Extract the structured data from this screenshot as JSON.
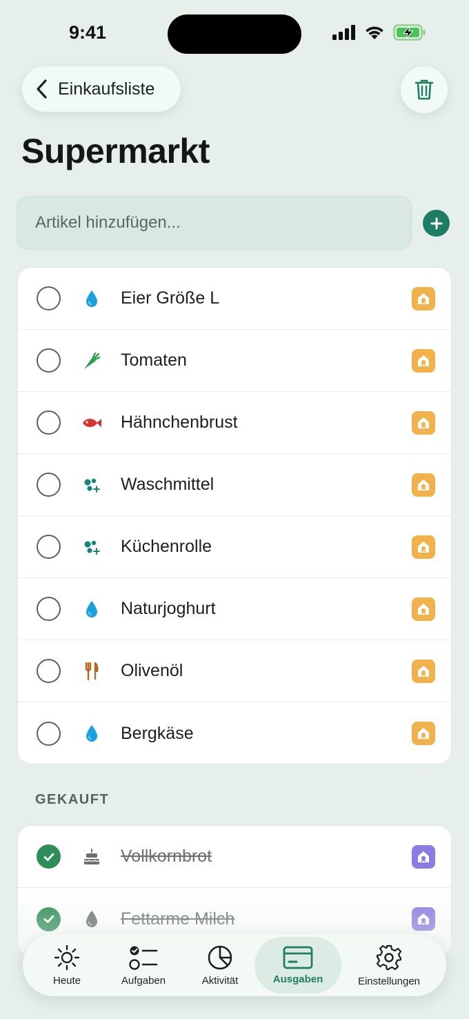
{
  "status": {
    "time": "9:41"
  },
  "header": {
    "back_label": "Einkaufsliste",
    "title": "Supermarkt"
  },
  "add": {
    "placeholder": "Artikel hinzufügen..."
  },
  "open_items": [
    {
      "name": "Eier Größe L",
      "icon": "water-drop-icon",
      "icon_color": "#1aa0e0"
    },
    {
      "name": "Tomaten",
      "icon": "carrot-icon",
      "icon_color": "#2a9d4a"
    },
    {
      "name": "Hähnchenbrust",
      "icon": "fish-icon",
      "icon_color": "#d8332b"
    },
    {
      "name": "Waschmittel",
      "icon": "bubbles-icon",
      "icon_color": "#14857a"
    },
    {
      "name": "Küchenrolle",
      "icon": "bubbles-icon",
      "icon_color": "#14857a"
    },
    {
      "name": "Naturjoghurt",
      "icon": "water-drop-icon",
      "icon_color": "#1aa0e0"
    },
    {
      "name": "Olivenöl",
      "icon": "fork-knife-icon",
      "icon_color": "#b5651d"
    },
    {
      "name": "Bergkäse",
      "icon": "water-drop-icon",
      "icon_color": "#1aa0e0"
    }
  ],
  "bought_label": "GEKAUFT",
  "bought_items": [
    {
      "name": "Vollkornbrot",
      "icon": "cake-icon",
      "icon_color": "#6b6f72"
    },
    {
      "name": "Fettarme Milch",
      "icon": "water-drop-icon",
      "icon_color": "#6b6f72"
    }
  ],
  "tabs": [
    {
      "label": "Heute",
      "icon": "sun-icon"
    },
    {
      "label": "Aufgaben",
      "icon": "checklist-icon"
    },
    {
      "label": "Aktivität",
      "icon": "pie-chart-icon"
    },
    {
      "label": "Ausgaben",
      "icon": "card-icon",
      "active": true
    },
    {
      "label": "Einstellungen",
      "icon": "gear-icon"
    }
  ],
  "colors": {
    "accent": "#1d7e64",
    "checked": "#2f8d59",
    "member_orange": "#f2b24b",
    "member_purple": "#8b7be3"
  }
}
